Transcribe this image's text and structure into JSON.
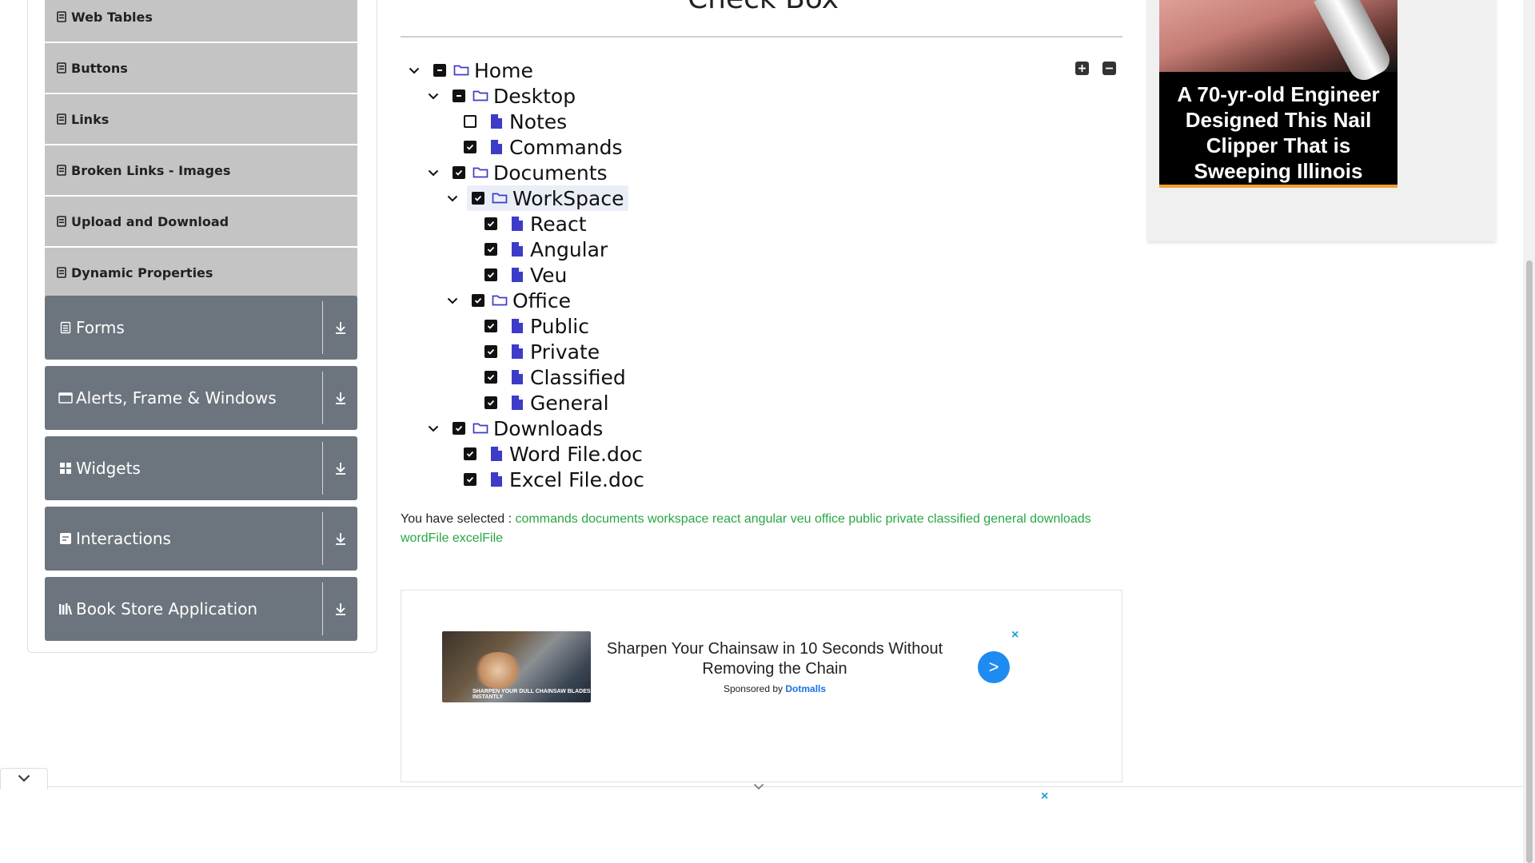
{
  "sidebar": {
    "sub_items": [
      {
        "label": "Web Tables"
      },
      {
        "label": "Buttons"
      },
      {
        "label": "Links"
      },
      {
        "label": "Broken Links - Images"
      },
      {
        "label": "Upload and Download"
      },
      {
        "label": "Dynamic Properties"
      }
    ],
    "groups": [
      {
        "label": "Forms",
        "icon": "form-icon"
      },
      {
        "label": "Alerts, Frame & Windows",
        "icon": "window-icon"
      },
      {
        "label": "Widgets",
        "icon": "widgets-icon"
      },
      {
        "label": "Interactions",
        "icon": "interactions-icon"
      },
      {
        "label": "Book Store Application",
        "icon": "books-icon"
      }
    ]
  },
  "main": {
    "title": "Check Box",
    "tree": {
      "home": "Home",
      "desktop": "Desktop",
      "notes": "Notes",
      "commands": "Commands",
      "documents": "Documents",
      "workspace": "WorkSpace",
      "react": "React",
      "angular": "Angular",
      "veu": "Veu",
      "office": "Office",
      "public": "Public",
      "private": "Private",
      "classified": "Classified",
      "general": "General",
      "downloads": "Downloads",
      "word": "Word File.doc",
      "excel": "Excel File.doc"
    },
    "result_prefix": "You have selected :",
    "result_items": "commands documents workspace react angular veu office public private classified general downloads wordFile excelFile"
  },
  "ads": {
    "bottom": {
      "headline": "Sharpen Your Chainsaw in 10 Seconds Without Removing the Chain",
      "sponsored_prefix": "Sponsored by",
      "sponsor": "Dotmalls",
      "thumb_caption": "Sharpen your dull chainsaw blades instantly",
      "go": ">",
      "close": "×"
    },
    "side": {
      "text": "A 70-yr-old Engineer Designed This Nail Clipper That is Sweeping Illinois"
    },
    "footer_close": "×"
  },
  "colors": {
    "accent_green": "#28a745",
    "sidebar_group": "#6c757d",
    "sidebar_item": "#c4c4c4",
    "tree_icon": "#3c3cc8"
  }
}
